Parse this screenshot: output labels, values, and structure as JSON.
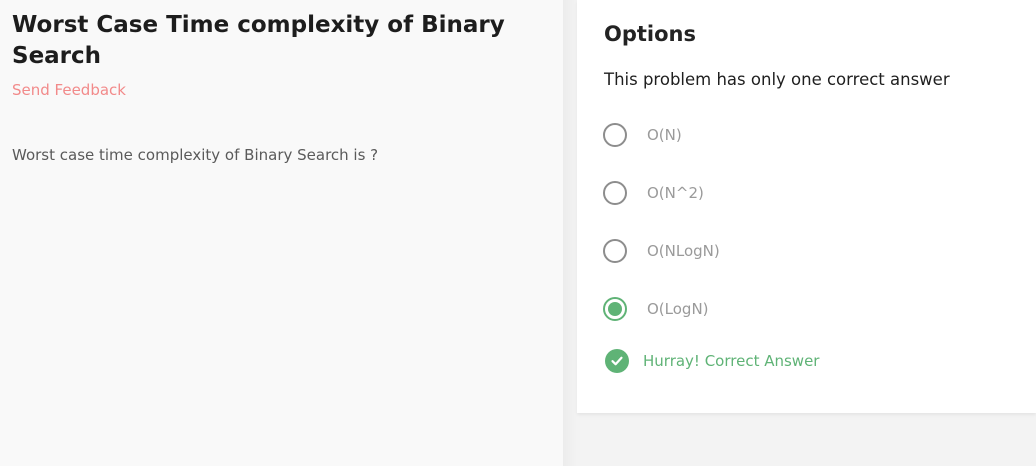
{
  "problem": {
    "title": "Worst Case Time complexity of Binary Search",
    "send_feedback_label": "Send Feedback",
    "question": "Worst case time complexity of Binary Search is ?"
  },
  "options_panel": {
    "heading": "Options",
    "subtitle": "This problem has only one correct answer",
    "options": [
      {
        "label": "O(N)",
        "selected": false
      },
      {
        "label": "O(N^2)",
        "selected": false
      },
      {
        "label": "O(NLogN)",
        "selected": false
      },
      {
        "label": "O(LogN)",
        "selected": true
      }
    ],
    "result_text": "Hurray! Correct Answer"
  },
  "colors": {
    "success": "#5fb376",
    "feedback_link": "#f28a8a"
  },
  "icons": {
    "result": "check-circle-icon",
    "option_unselected": "radio-unchecked-icon",
    "option_selected": "radio-checked-icon"
  }
}
